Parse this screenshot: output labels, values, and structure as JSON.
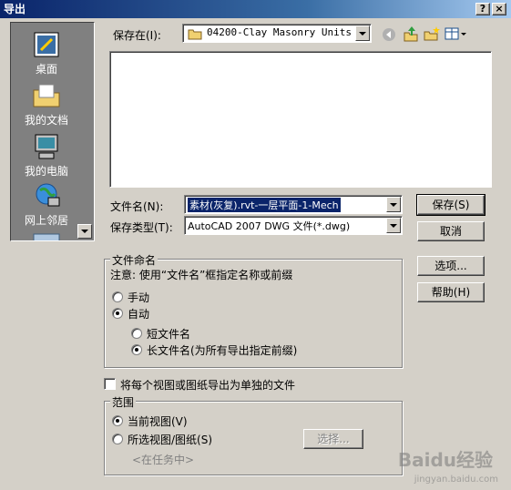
{
  "window": {
    "title": "导出"
  },
  "places": [
    {
      "label": "桌面",
      "icon": "desktop-icon"
    },
    {
      "label": "我的文档",
      "icon": "my-documents-icon"
    },
    {
      "label": "我的电脑",
      "icon": "my-computer-icon"
    },
    {
      "label": "网上邻居",
      "icon": "network-icon"
    }
  ],
  "save_in": {
    "label": "保存在(I):",
    "value": "04200-Clay Masonry Units"
  },
  "filename": {
    "label": "文件名(N):",
    "value": "素材(灰复).rvt-一层平面-1-Mech"
  },
  "filetype": {
    "label": "保存类型(T):",
    "value": "AutoCAD 2007 DWG 文件(*.dwg)"
  },
  "buttons": {
    "save": "保存(S)",
    "cancel": "取消",
    "options": "选项...",
    "help": "帮助(H)",
    "select": "选择..."
  },
  "naming": {
    "title": "文件命名",
    "note": "注意: 使用“文件名”框指定名称或前缀",
    "manual": "手动",
    "auto": "自动",
    "short_name": "短文件名",
    "long_name": "长文件名(为所有导出指定前缀)"
  },
  "separate_files": "将每个视图或图纸导出为单独的文件",
  "range": {
    "title": "范围",
    "current_view": "当前视图(V)",
    "selected_views": "所选视图/图纸(S)",
    "in_session": "<在任务中>"
  },
  "watermark": {
    "brand": "Baidu经验",
    "url": "jingyan.baidu.com"
  }
}
